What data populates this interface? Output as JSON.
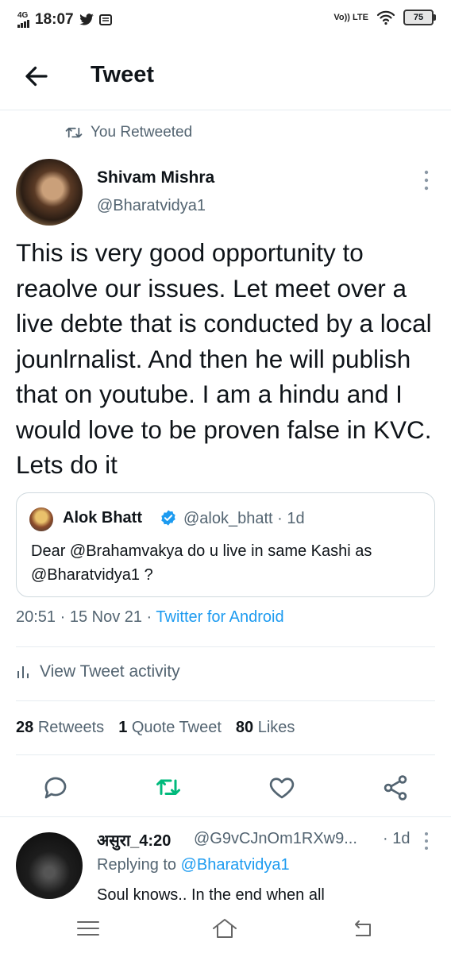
{
  "status_bar": {
    "network": "4G",
    "time": "18:07",
    "volte": "Vo)) LTE",
    "battery": "75"
  },
  "header": {
    "title": "Tweet"
  },
  "retweet_context": "You Retweeted",
  "tweet": {
    "author_name": "Shivam Mishra",
    "author_handle": "@Bharatvidya1",
    "text": "This is very good opportunity to reaolve our issues. Let meet over a live debte that is conducted by a local jounlrnalist. And then he will publish that on youtube. I am a hindu and I would love to be proven false in KVC. Lets do it",
    "quote": {
      "author_name": "Alok Bhatt",
      "meta": "@alok_bhatt · 1d",
      "text": "Dear @Brahamvakya do u live in same Kashi as @Bharatvidya1 ?"
    },
    "timestamp": "20:51 · 15 Nov 21 · ",
    "source": "Twitter for Android",
    "activity_label": "View Tweet activity",
    "stats": {
      "retweets_count": "28",
      "retweets_label": "Retweets",
      "quotes_count": "1",
      "quotes_label": "Quote Tweet",
      "likes_count": "80",
      "likes_label": "Likes"
    }
  },
  "reply": {
    "author_name": "असुरा_4:20",
    "author_handle": "@G9vCJnOm1RXw9...",
    "time": "· 1d",
    "replying_prefix": "Replying to ",
    "replying_to": "@Bharatvidya1",
    "text": "Soul knows.. In the end when all"
  },
  "colors": {
    "accent": "#1d9bf0",
    "retweet_green": "#00ba7c",
    "secondary_text": "#536471"
  },
  "icons": [
    "back-arrow-icon",
    "retweet-icon",
    "more-vertical-icon",
    "verified-badge-icon",
    "bar-chart-icon",
    "reply-icon",
    "share-icon",
    "like-icon",
    "menu-icon",
    "home-icon",
    "back-nav-icon",
    "wifi-icon",
    "twitter-icon",
    "mail-icon"
  ]
}
